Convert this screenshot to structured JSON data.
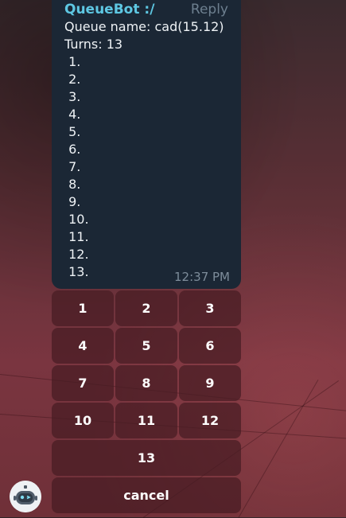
{
  "message": {
    "sender": "QueueBot :/",
    "reply_label": "Reply",
    "lines": [
      "Queue name: cad(15.12)",
      "Turns: 13",
      " 1.",
      " 2.",
      " 3.",
      " 4.",
      " 5.",
      " 6.",
      " 7.",
      " 8.",
      " 9.",
      " 10.",
      " 11.",
      " 12.",
      " 13."
    ],
    "time": "12:37 PM"
  },
  "keyboard": {
    "rows": [
      [
        "1",
        "2",
        "3"
      ],
      [
        "4",
        "5",
        "6"
      ],
      [
        "7",
        "8",
        "9"
      ],
      [
        "10",
        "11",
        "12"
      ],
      [
        "13"
      ],
      [
        "cancel"
      ]
    ]
  },
  "avatar": {
    "icon": "robot-face-icon"
  }
}
